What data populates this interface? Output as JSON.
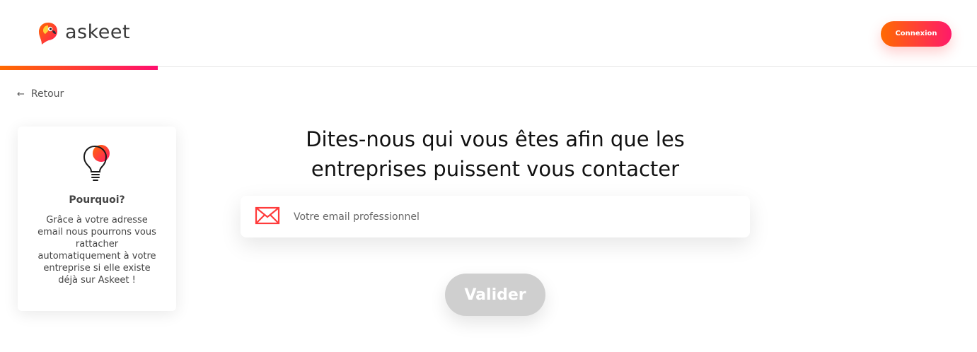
{
  "brand": {
    "name": "askeet",
    "accent_start": "#ff6a00",
    "accent_end": "#ff0f6f",
    "logo_icon": "parrot-icon"
  },
  "header": {
    "login_label": "Connexion"
  },
  "progress": {
    "fraction": 0.16
  },
  "nav": {
    "back_label": "Retour",
    "back_icon": "arrow-left-icon"
  },
  "why_card": {
    "icon": "lightbulb-icon",
    "title": "Pourquoi?",
    "text": "Grâce à votre adresse email nous pourrons vous rattacher automatiquement à votre entreprise si elle existe déjà sur Askeet !"
  },
  "main": {
    "title_line1": "Dites-nous qui vous êtes afin que les",
    "title_line2": "entreprises puissent vous contacter",
    "email": {
      "icon": "mail-icon",
      "value": "",
      "placeholder": "Votre email professionnel"
    },
    "submit_label": "Valider",
    "submit_color": "#cfcfcf"
  }
}
